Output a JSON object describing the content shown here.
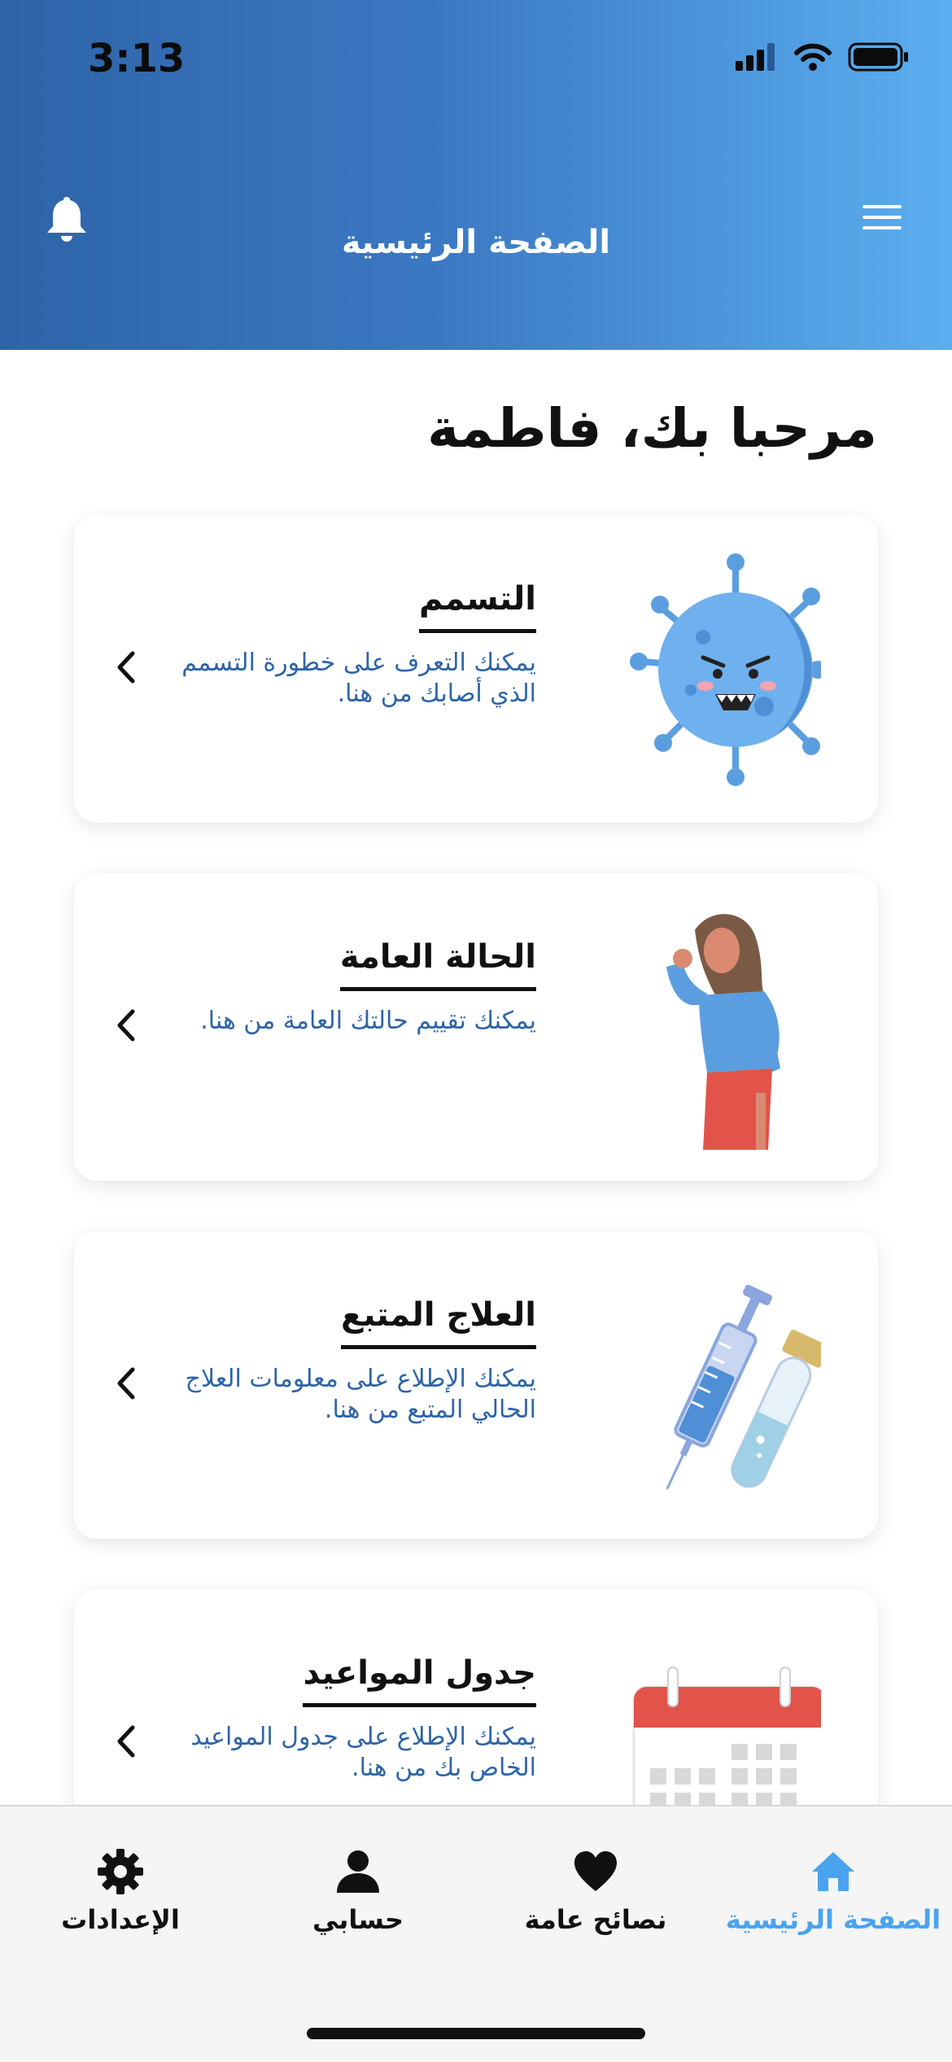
{
  "status_bar": {
    "time": "3:13"
  },
  "header": {
    "title": "الصفحة الرئيسية"
  },
  "welcome": "مرحبا بك، فاطمة",
  "cards": [
    {
      "title": "التسمم",
      "description": "يمكنك التعرف على خطورة التسمم الذي أصابك من هنا.",
      "illustration": "virus-illustration"
    },
    {
      "title": "الحالة العامة",
      "description": "يمكنك تقييم حالتك العامة من هنا.",
      "illustration": "sick-woman-illustration"
    },
    {
      "title": "العلاج المتبع",
      "description": "يمكنك الإطلاع على معلومات العلاج الحالي المتبع من هنا.",
      "illustration": "syringe-vial-illustration"
    },
    {
      "title": "جدول المواعيد",
      "description": "يمكنك الإطلاع على جدول المواعيد الخاص بك من هنا.",
      "illustration": "calendar-illustration"
    }
  ],
  "tabbar": {
    "home": "الصفحة الرئيسية",
    "tips": "نصائح عامة",
    "account": "حسابي",
    "settings": "الإعدادات"
  },
  "colors": {
    "accent": "#4aa3ee",
    "header_start": "#2e64a8",
    "header_end": "#5aaeef",
    "description": "#2e64a8"
  }
}
